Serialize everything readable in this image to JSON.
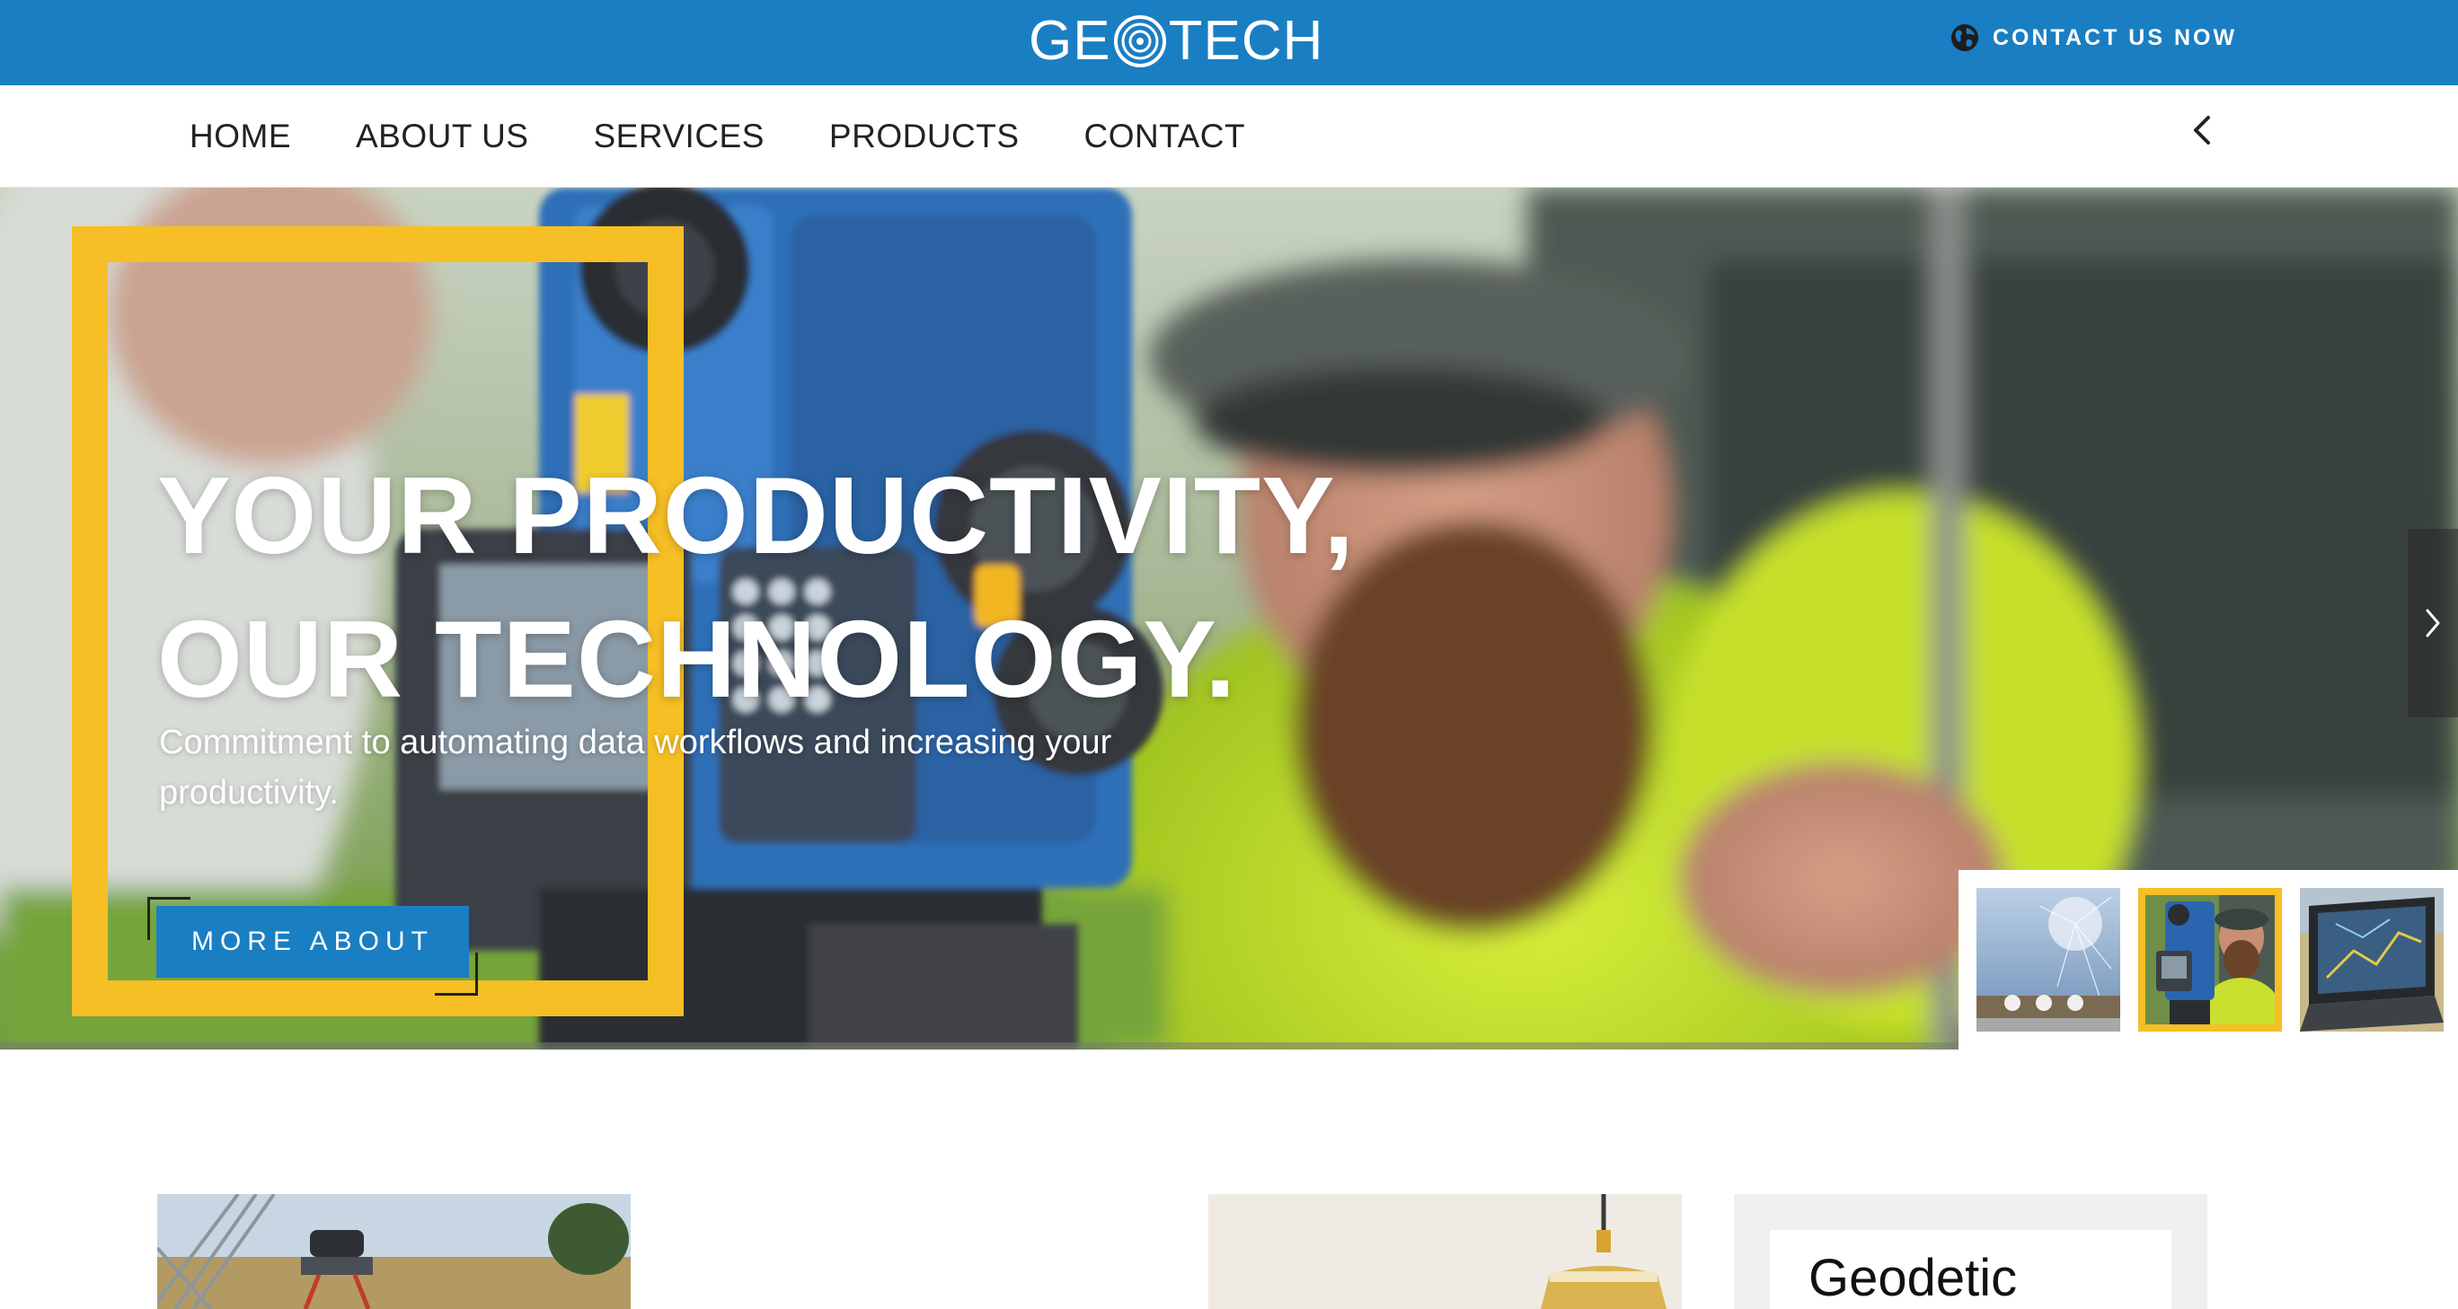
{
  "brand": {
    "logo_text": "GEOTECH",
    "logo_left": "GE",
    "logo_right": "TECH",
    "primary_color": "#1a7ec3",
    "accent_color": "#f5bf25"
  },
  "topbar": {
    "contact_label": "CONTACT US NOW",
    "contact_icon": "globe-icon"
  },
  "nav": {
    "items": [
      {
        "label": "HOME"
      },
      {
        "label": "ABOUT US"
      },
      {
        "label": "SERVICES"
      },
      {
        "label": "PRODUCTS"
      },
      {
        "label": "CONTACT"
      }
    ],
    "toggle_icon": "chevron-left-icon"
  },
  "hero": {
    "title_line1": "YOUR PRODUCTIVITY,",
    "title_line2": "OUR TECHNOLOGY.",
    "subtitle": "Commitment to automating data workflows and increasing your productivity.",
    "cta_label": "MORE ABOUT",
    "next_icon": "chevron-right-icon",
    "active_slide": 2,
    "slide_count": 3
  },
  "thumbnails": [
    {
      "name": "thumb-network",
      "active": false
    },
    {
      "name": "thumb-surveyor",
      "active": true
    },
    {
      "name": "thumb-laptop",
      "active": false
    }
  ],
  "cards": {
    "heading": "Geodetic"
  }
}
